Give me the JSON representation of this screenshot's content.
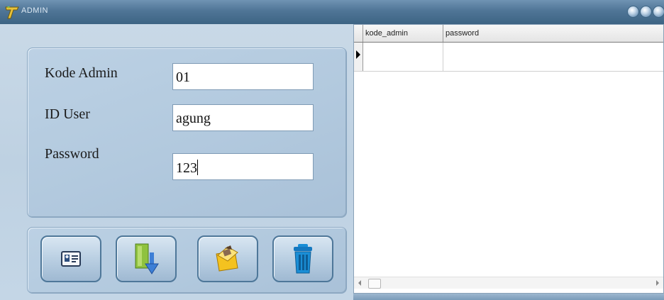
{
  "window": {
    "title": "ADMIN",
    "logo_icon": "app-logo-icon",
    "accent": "#4f7596"
  },
  "form": {
    "fields": [
      {
        "label": "Kode Admin",
        "value": "01"
      },
      {
        "label": "ID User",
        "value": "agung"
      },
      {
        "label": "Password",
        "value": "123"
      }
    ]
  },
  "toolbar": {
    "buttons": [
      {
        "icon": "id-card-icon"
      },
      {
        "icon": "save-download-icon"
      },
      {
        "icon": "edit-folder-icon"
      },
      {
        "icon": "trash-icon"
      }
    ]
  },
  "grid": {
    "columns": [
      "kode_admin",
      "password"
    ],
    "rows": [
      [
        "",
        ""
      ]
    ]
  }
}
